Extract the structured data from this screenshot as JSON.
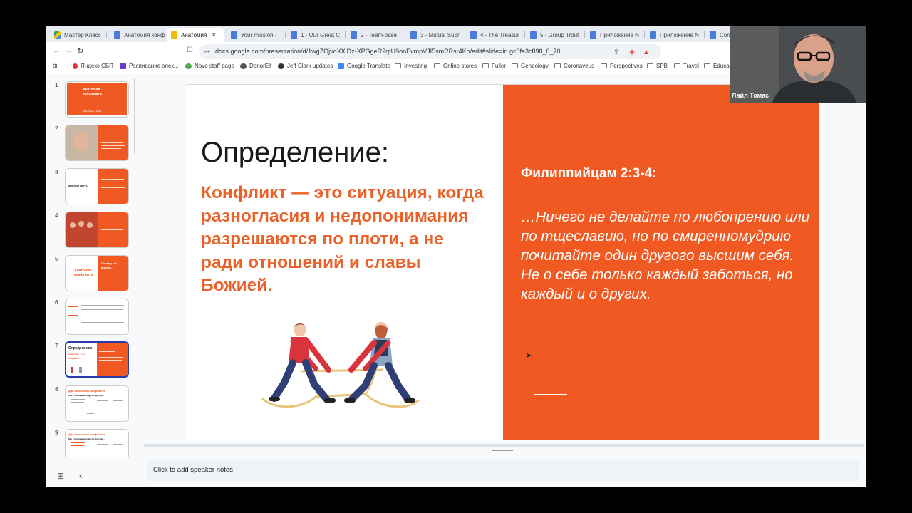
{
  "browser": {
    "tabs": [
      {
        "label": "Мастер Класс",
        "icon": "drive"
      },
      {
        "label": "Анатомия конф",
        "icon": "docs"
      },
      {
        "label": "Анатомия",
        "icon": "slides",
        "active": true,
        "close": "✕"
      },
      {
        "label": "Your mission -",
        "icon": "docs"
      },
      {
        "label": "1 - Our Great C",
        "icon": "docs"
      },
      {
        "label": "2 - Team-base",
        "icon": "docs"
      },
      {
        "label": "3 - Mutual Subr",
        "icon": "docs"
      },
      {
        "label": "4 - The Treasur",
        "icon": "docs"
      },
      {
        "label": "5 - Group Trout",
        "icon": "docs"
      },
      {
        "label": "Приложение N",
        "icon": "docs"
      },
      {
        "label": "Приложение N",
        "icon": "docs"
      },
      {
        "label": "Conf",
        "icon": "docs"
      }
    ],
    "nav": {
      "back": "←",
      "forward": "→",
      "reload": "↻",
      "bookmark": "☐"
    },
    "url": "docs.google.com/presentation/d/1wgZOjvoXXiDz-XPGgeR2qtU9onEvmpVJI5smRRsr4Ko/edit#slide=id.gc6fa3c898_0_70",
    "site_icon": "⊶",
    "bookmarks": [
      {
        "label": "Яндекс СБП",
        "type": "pin"
      },
      {
        "label": "Расписание элек...",
        "type": "site"
      },
      {
        "label": "Novo staff page",
        "type": "site"
      },
      {
        "label": "DonorElf",
        "type": "site"
      },
      {
        "label": "Jeff Clark updates",
        "type": "site"
      },
      {
        "label": "Google Translate",
        "type": "site"
      },
      {
        "label": "Investing",
        "type": "folder"
      },
      {
        "label": "Online stores",
        "type": "folder"
      },
      {
        "label": "Fuller",
        "type": "folder"
      },
      {
        "label": "Geneology",
        "type": "folder"
      },
      {
        "label": "Coronavirus",
        "type": "folder"
      },
      {
        "label": "Perspectives",
        "type": "folder"
      },
      {
        "label": "SPB",
        "type": "folder"
      },
      {
        "label": "Travel",
        "type": "folder"
      },
      {
        "label": "Educa",
        "type": "folder"
      }
    ]
  },
  "filmstrip": {
    "numbers": [
      "1",
      "2",
      "3",
      "4",
      "5",
      "6",
      "7",
      "8",
      "9"
    ],
    "slide1": {
      "title": "Анатомия конфликта",
      "sub": "Лайл Томас · 2023"
    },
    "slide3": {
      "logo": "Миссия NOVO"
    },
    "slide5": {
      "title": "Анатомия конфликта",
      "side": "Почему мы иногда..."
    },
    "slide7": {
      "title": "Определение:",
      "body": "Конфликт — это ситуация..."
    },
    "slide8": {
      "title": "Два источника конфликта",
      "sub": "Мы сталкиваемся друг с другом..."
    },
    "slide9": {
      "title": "Два источника конфликта",
      "sub": "Мы сталкиваемся друг с другом..."
    }
  },
  "slide": {
    "title": "Определение:",
    "definition": "Конфликт — это ситуация, когда разногласия и недопонимания разрешаются по плоти, а не ради отношений и славы Божией.",
    "verse_ref": "Филиппийцам 2:3-4:",
    "verse": "…Ничего не делайте по любопрению или по тщеславию, но по смиренномудрию почитайте один другого высшим себя. Не о себе только каждый заботься, но каждый и о других.",
    "accent_color": "#f05a22"
  },
  "notes": {
    "placeholder": "Click to add speaker notes"
  },
  "bottom": {
    "grid": "⊞",
    "collapse": "‹"
  },
  "video": {
    "name": "Лайл Томас"
  }
}
